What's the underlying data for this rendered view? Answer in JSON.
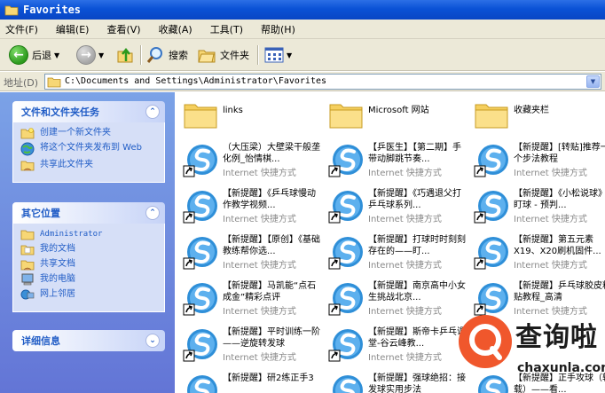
{
  "window": {
    "title": "Favorites"
  },
  "menu": [
    "文件(F)",
    "编辑(E)",
    "查看(V)",
    "收藏(A)",
    "工具(T)",
    "帮助(H)"
  ],
  "toolbar": {
    "back_label": "后退",
    "search_label": "搜索",
    "folders_label": "文件夹"
  },
  "address": {
    "label": "地址(D)",
    "path": "C:\\Documents and Settings\\Administrator\\Favorites"
  },
  "tasks": {
    "title": "文件和文件夹任务",
    "items": [
      "创建一个新文件夹",
      "将这个文件夹发布到 Web",
      "共享此文件夹"
    ]
  },
  "places": {
    "title": "其它位置",
    "items": [
      "Administrator",
      "我的文档",
      "共享文档",
      "我的电脑",
      "网上邻居"
    ]
  },
  "details": {
    "title": "详细信息"
  },
  "folders": [
    "links",
    "Microsoft 网站",
    "收藏夹栏"
  ],
  "shortcut_type": "Internet 快捷方式",
  "shortcuts": [
    "（大压梁）大壁梁干般垄化例_怡情棋...",
    "【乒医生】【第二期】手带动脚跳节奏...",
    "【新提醒】[转贴]推荐一个步法教程",
    "【新提醒】《乒乓球慢动作教学视频...",
    "【新提醒】《巧遇退父打乒乓球系列...",
    "【新提醒】《小松说球》盯球 - 预判...",
    "【新提醒】【原创】《基础教练帮你选...",
    "【新提醒】打球时时刻刻存在的——盯...",
    "【新提醒】第五元素X19、X20刷机固件...",
    "【新提醒】马凯能“点石成金”精彩点评",
    "【新提醒】南京高中小女生挑战北京...",
    "【新提醒】乒乓球胶皮粘贴教程_高清",
    "【新提醒】平时训练一阶——逆旋转发球",
    "【新提醒】斯帝卡乒乓课堂-谷云峰教...",
    "",
    "【新提醒】研2练正手3",
    "【新提醒】强球绝招：接发球实用步法",
    "【新提醒】正手攻球（转载）——看..."
  ],
  "watermark": {
    "brand": "查询啦",
    "url": "chaxunla.com"
  }
}
